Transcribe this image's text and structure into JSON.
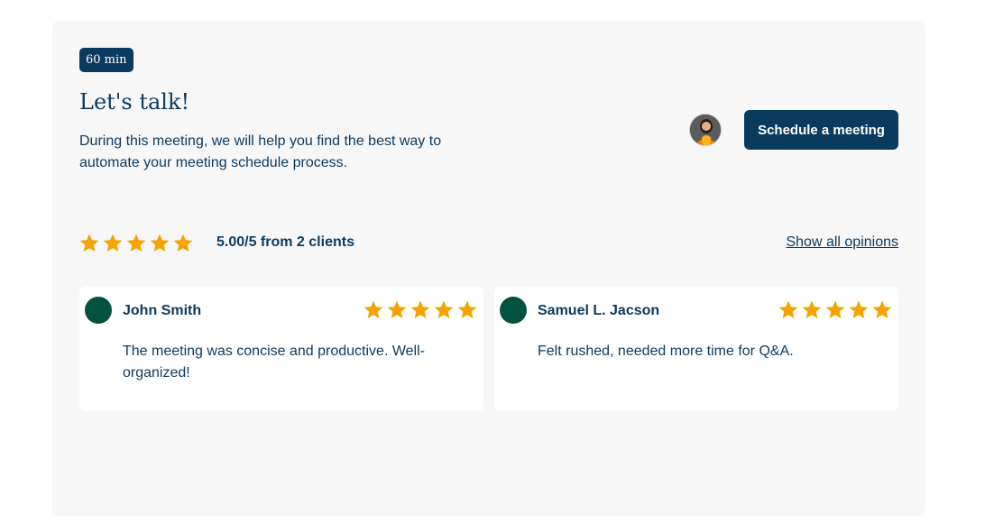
{
  "meeting": {
    "duration_label": "60 min",
    "title": "Let's talk!",
    "description": "During this meeting, we will help you find the best way to automate your meeting schedule process.",
    "schedule_button_label": "Schedule a meeting"
  },
  "rating": {
    "stars": 5,
    "summary": "5.00/5 from 2 clients",
    "show_all_label": "Show all opinions"
  },
  "reviews": [
    {
      "name": "John Smith",
      "stars": 5,
      "text": "The meeting was concise and productive. Well-organized!",
      "avatar_color": "#03523f"
    },
    {
      "name": "Samuel L. Jacson",
      "stars": 5,
      "text": "Felt rushed, needed more time for Q&A.",
      "avatar_color": "#03523f"
    }
  ],
  "colors": {
    "primary": "#0b3a5f",
    "star": "#f5a300",
    "card_background": "#f7f7f7"
  },
  "icons": {
    "star": "star-icon",
    "host_avatar": "host-avatar"
  }
}
